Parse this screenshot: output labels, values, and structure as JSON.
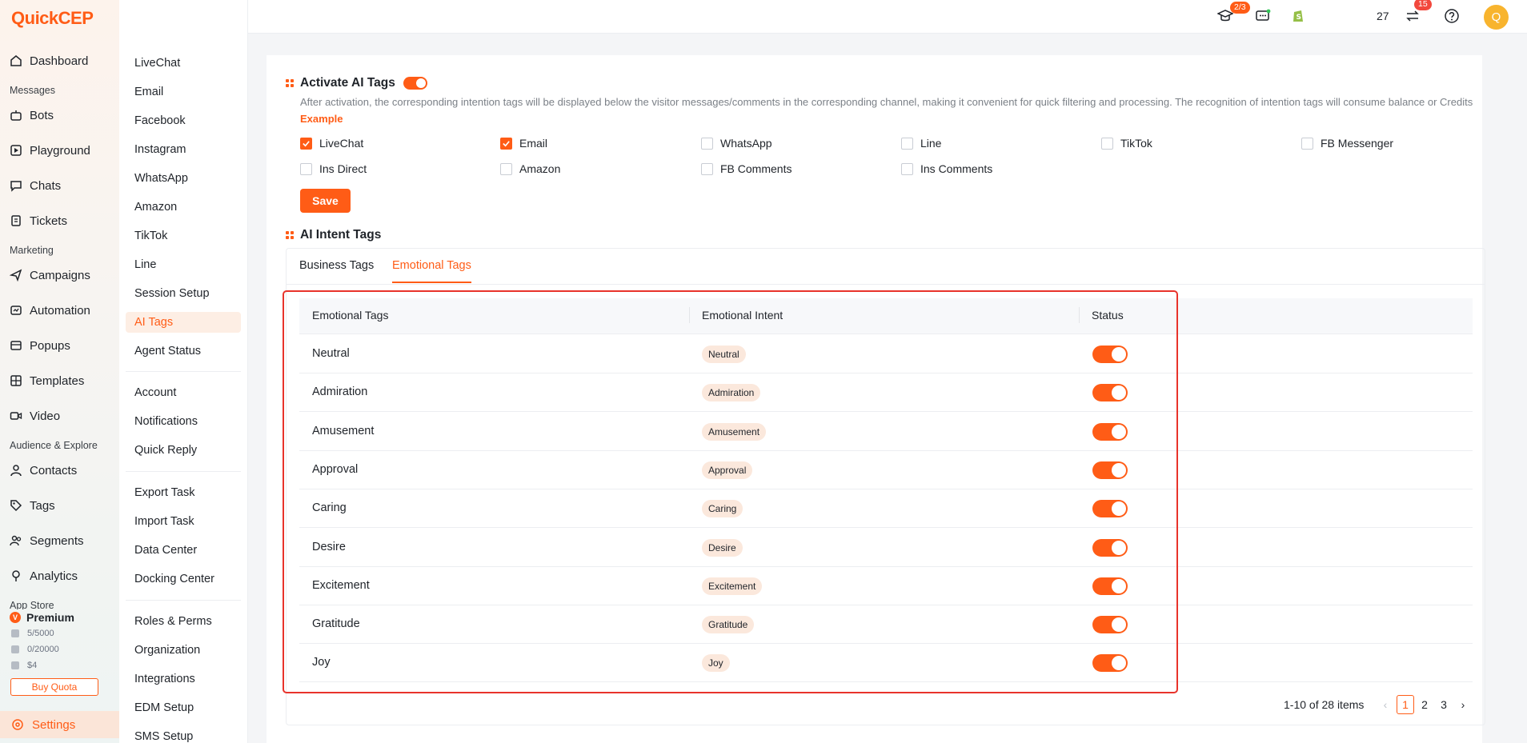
{
  "brand": {
    "logo_q": "Q",
    "logo_rest": "uick",
    "logo_cep": "CEP"
  },
  "nav": {
    "dashboard": "Dashboard",
    "messages_section": "Messages",
    "bots": "Bots",
    "playground": "Playground",
    "chats": "Chats",
    "tickets": "Tickets",
    "marketing_section": "Marketing",
    "campaigns": "Campaigns",
    "automation": "Automation",
    "popups": "Popups",
    "templates": "Templates",
    "video": "Video",
    "audience_section": "Audience & Explore",
    "contacts": "Contacts",
    "tags": "Tags",
    "segments": "Segments",
    "analytics": "Analytics",
    "appstore_section": "App Store",
    "settings": "Settings"
  },
  "plan": {
    "name": "Premium",
    "badge": "V",
    "quota1": "5/5000",
    "quota2": "0/20000",
    "quota3": "$4",
    "buy_quota": "Buy Quota"
  },
  "subnav": {
    "group1": [
      "LiveChat",
      "Email",
      "Facebook",
      "Instagram",
      "WhatsApp",
      "Amazon",
      "TikTok",
      "Line",
      "Session Setup",
      "AI Tags",
      "Agent Status"
    ],
    "group2": [
      "Account",
      "Notifications",
      "Quick Reply"
    ],
    "group3": [
      "Export Task",
      "Import Task",
      "Data Center",
      "Docking Center"
    ],
    "group4": [
      "Roles & Perms",
      "Organization",
      "Integrations",
      "EDM Setup",
      "SMS Setup"
    ],
    "active": "AI Tags"
  },
  "topbar": {
    "learn_badge": "2/3",
    "count_label": "27",
    "transfer_badge": "15",
    "avatar_letter": "Q"
  },
  "activate": {
    "title": "Activate AI Tags",
    "desc": "After activation, the corresponding intention tags will be displayed below the visitor messages/comments in the corresponding channel, making it convenient for quick filtering and processing. The recognition of intention tags will consume balance or Credits",
    "example_link": "Example",
    "channels": [
      {
        "label": "LiveChat",
        "checked": true
      },
      {
        "label": "Email",
        "checked": true
      },
      {
        "label": "WhatsApp",
        "checked": false
      },
      {
        "label": "Line",
        "checked": false
      },
      {
        "label": "TikTok",
        "checked": false
      },
      {
        "label": "FB Messenger",
        "checked": false
      },
      {
        "label": "Ins Direct",
        "checked": false
      },
      {
        "label": "Amazon",
        "checked": false
      },
      {
        "label": "FB Comments",
        "checked": false
      },
      {
        "label": "Ins Comments",
        "checked": false
      }
    ],
    "save": "Save"
  },
  "intent": {
    "title": "AI Intent Tags",
    "tabs": [
      "Business Tags",
      "Emotional Tags"
    ],
    "active_tab": "Emotional Tags",
    "columns": [
      "Emotional Tags",
      "Emotional Intent",
      "Status"
    ],
    "rows": [
      {
        "tag": "Neutral",
        "intent": "Neutral",
        "enabled": true
      },
      {
        "tag": "Admiration",
        "intent": "Admiration",
        "enabled": true
      },
      {
        "tag": "Amusement",
        "intent": "Amusement",
        "enabled": true
      },
      {
        "tag": "Approval",
        "intent": "Approval",
        "enabled": true
      },
      {
        "tag": "Caring",
        "intent": "Caring",
        "enabled": true
      },
      {
        "tag": "Desire",
        "intent": "Desire",
        "enabled": true
      },
      {
        "tag": "Excitement",
        "intent": "Excitement",
        "enabled": true
      },
      {
        "tag": "Gratitude",
        "intent": "Gratitude",
        "enabled": true
      },
      {
        "tag": "Joy",
        "intent": "Joy",
        "enabled": true
      }
    ]
  },
  "pagination": {
    "summary": "1-10 of 28 items",
    "pages": [
      "1",
      "2",
      "3"
    ],
    "current": "1",
    "prev": "‹",
    "next": "›"
  },
  "colors": {
    "accent": "#ff5c16",
    "highlight": "#e8332b"
  }
}
